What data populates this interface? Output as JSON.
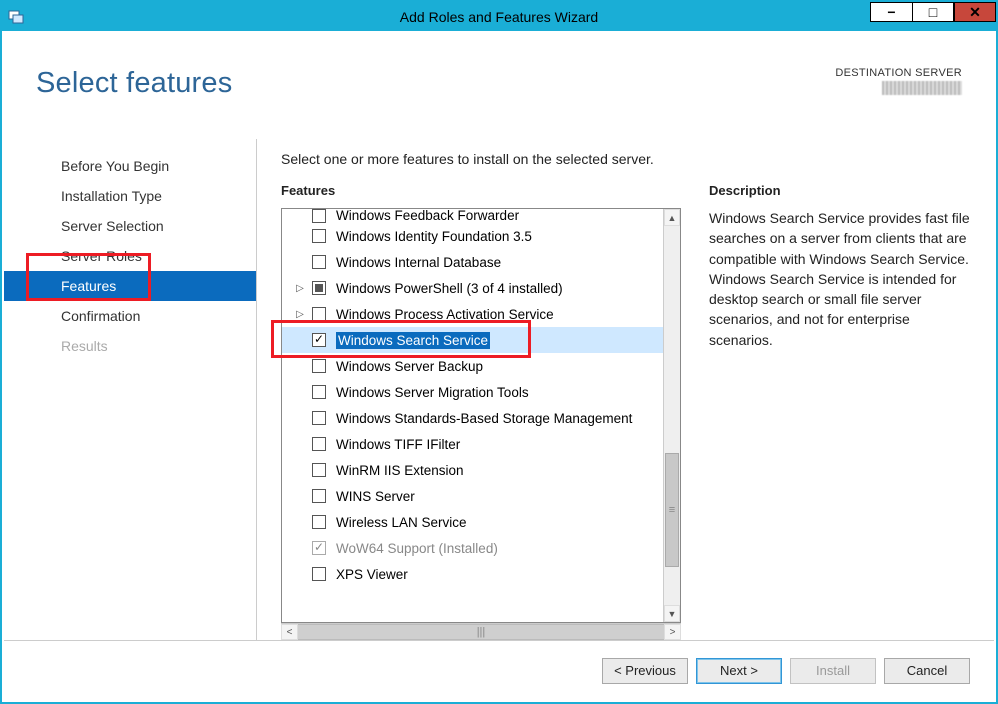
{
  "window": {
    "title": "Add Roles and Features Wizard"
  },
  "heading": "Select features",
  "destination": {
    "label": "DESTINATION SERVER"
  },
  "nav": {
    "items": [
      {
        "label": "Before You Begin",
        "state": "normal"
      },
      {
        "label": "Installation Type",
        "state": "normal"
      },
      {
        "label": "Server Selection",
        "state": "normal"
      },
      {
        "label": "Server Roles",
        "state": "normal"
      },
      {
        "label": "Features",
        "state": "selected"
      },
      {
        "label": "Confirmation",
        "state": "normal"
      },
      {
        "label": "Results",
        "state": "disabled"
      }
    ]
  },
  "instruction": "Select one or more features to install on the selected server.",
  "features_heading": "Features",
  "description_heading": "Description",
  "features": [
    {
      "label": "Windows Feedback Forwarder",
      "checked": false,
      "expandable": false,
      "partialTop": true
    },
    {
      "label": "Windows Identity Foundation 3.5",
      "checked": false
    },
    {
      "label": "Windows Internal Database",
      "checked": false
    },
    {
      "label": "Windows PowerShell (3 of 4 installed)",
      "checked": "partial",
      "expandable": true
    },
    {
      "label": "Windows Process Activation Service",
      "checked": false,
      "expandable": true
    },
    {
      "label": "Windows Search Service",
      "checked": true,
      "selected": true
    },
    {
      "label": "Windows Server Backup",
      "checked": false
    },
    {
      "label": "Windows Server Migration Tools",
      "checked": false
    },
    {
      "label": "Windows Standards-Based Storage Management",
      "checked": false
    },
    {
      "label": "Windows TIFF IFilter",
      "checked": false
    },
    {
      "label": "WinRM IIS Extension",
      "checked": false
    },
    {
      "label": "WINS Server",
      "checked": false
    },
    {
      "label": "Wireless LAN Service",
      "checked": false
    },
    {
      "label": "WoW64 Support (Installed)",
      "checked": true,
      "disabled": true
    },
    {
      "label": "XPS Viewer",
      "checked": false
    }
  ],
  "description_text": "Windows Search Service provides fast file searches on a server from clients that are compatible with Windows Search Service. Windows Search Service is intended for desktop search or small file server scenarios, and not for enterprise scenarios.",
  "buttons": {
    "previous": "< Previous",
    "next": "Next >",
    "install": "Install",
    "cancel": "Cancel"
  }
}
